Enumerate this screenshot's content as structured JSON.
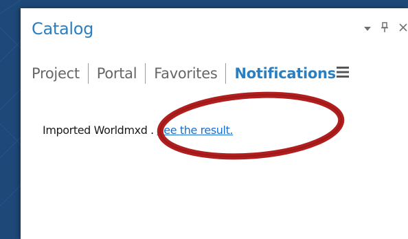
{
  "panel": {
    "title": "Catalog",
    "controls": [
      "chevron-down-icon",
      "pin-icon",
      "close-icon"
    ]
  },
  "tabs": {
    "items": [
      "Project",
      "Portal",
      "Favorites",
      "Notifications"
    ],
    "active": "Notifications"
  },
  "notification": {
    "prefix": "Imported  World",
    "middle": "mxd . ",
    "link": "See the result."
  },
  "colors": {
    "accent": "#2b7fc1",
    "link": "#1a6fd1",
    "annotation": "#b01e1e",
    "background": "#1d4878"
  }
}
